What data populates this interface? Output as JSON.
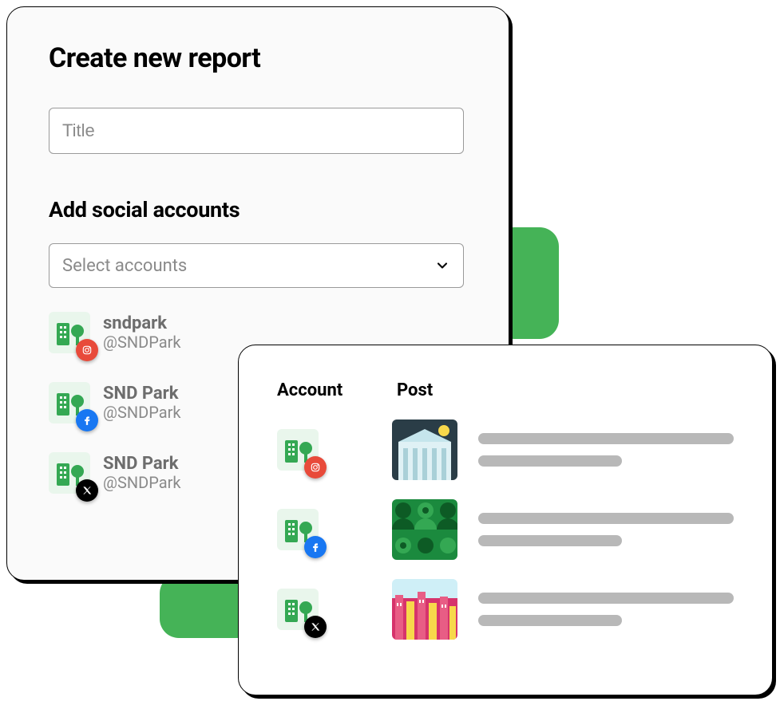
{
  "create": {
    "title": "Create new report",
    "title_placeholder": "Title",
    "section_heading": "Add social accounts",
    "select_placeholder": "Select accounts"
  },
  "accounts": [
    {
      "name": "sndpark",
      "handle": "@SNDPark",
      "platform": "instagram"
    },
    {
      "name": "SND Park",
      "handle": "@SNDPark",
      "platform": "facebook"
    },
    {
      "name": "SND Park",
      "handle": "@SNDPark",
      "platform": "x"
    }
  ],
  "table": {
    "headers": {
      "account": "Account",
      "post": "Post"
    },
    "rows": [
      {
        "platform": "instagram",
        "thumb": "museum"
      },
      {
        "platform": "facebook",
        "thumb": "pattern"
      },
      {
        "platform": "x",
        "thumb": "city"
      }
    ]
  }
}
